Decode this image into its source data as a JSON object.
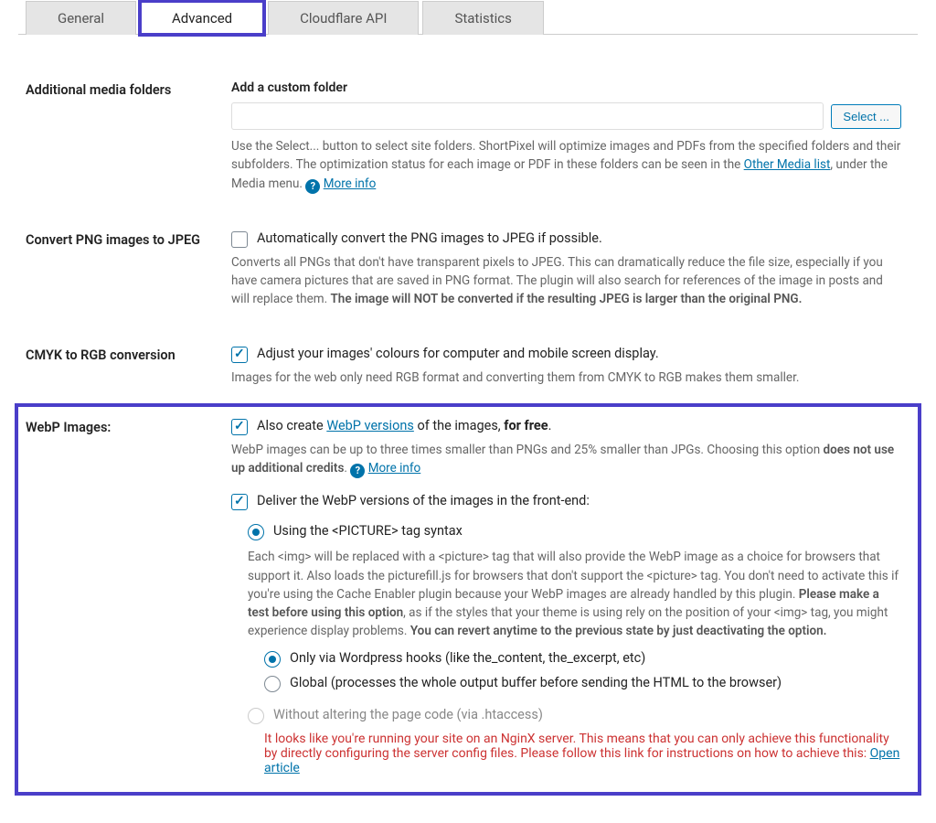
{
  "tabs": {
    "general": "General",
    "advanced": "Advanced",
    "cloudflare": "Cloudflare API",
    "statistics": "Statistics"
  },
  "folders": {
    "row_label": "Additional media folders",
    "heading": "Add a custom folder",
    "select_btn": "Select ...",
    "desc1": "Use the Select... button to select site folders. ShortPixel will optimize images and PDFs from the specified folders and their subfolders. The optimization status for each image or PDF in these folders can be seen in the ",
    "other_media_link": "Other Media list",
    "desc2": ", under the Media menu. ",
    "more_info": "More info"
  },
  "png": {
    "row_label": "Convert PNG images to JPEG",
    "checkbox_label": "Automatically convert the PNG images to JPEG if possible.",
    "desc_main": "Converts all PNGs that don't have transparent pixels to JPEG. This can dramatically reduce the file size, especially if you have camera pictures that are saved in PNG format. The plugin will also search for references of the image in posts and will replace them. ",
    "desc_bold": "The image will NOT be converted if the resulting JPEG is larger than the original PNG."
  },
  "cmyk": {
    "row_label": "CMYK to RGB conversion",
    "checkbox_label": "Adjust your images' colours for computer and mobile screen display.",
    "desc": "Images for the web only need RGB format and converting them from CMYK to RGB makes them smaller."
  },
  "webp": {
    "row_label": "WebP Images:",
    "create_prefix": "Also create ",
    "create_link": "WebP versions",
    "create_mid": " of the images, ",
    "create_bold": "for free",
    "create_dot": ".",
    "desc1": "WebP images can be up to three times smaller than PNGs and 25% smaller than JPGs. Choosing this option ",
    "desc_bold": "does not use up additional credits",
    "desc_dot": ". ",
    "more_info": "More info",
    "deliver_label": "Deliver the WebP versions of the images in the front-end:",
    "radio_picture": "Using the <PICTURE> tag syntax",
    "picture_desc1": "Each <img> will be replaced with a <picture> tag that will also provide the WebP image as a choice for browsers that support it. Also loads the picturefill.js for browsers that don't support the <picture> tag. You don't need to activate this if you're using the Cache Enabler plugin because your WebP images are already handled by this plugin. ",
    "picture_bold1": "Please make a test before using this option",
    "picture_desc2": ", as if the styles that your theme is using rely on the position of your <img> tag, you might experience display problems. ",
    "picture_bold2": "You can revert anytime to the previous state by just deactivating the option.",
    "radio_hooks": "Only via Wordpress hooks (like the_content, the_excerpt, etc)",
    "radio_global": "Global (processes the whole output buffer before sending the HTML to the browser)",
    "radio_htaccess": "Without altering the page code (via .htaccess)",
    "nginx_warn": "It looks like you're running your site on an NginX server. This means that you can only achieve this functionality by directly configuring the server config files. Please follow this link for instructions on how to achieve this: ",
    "nginx_link": "Open article"
  }
}
